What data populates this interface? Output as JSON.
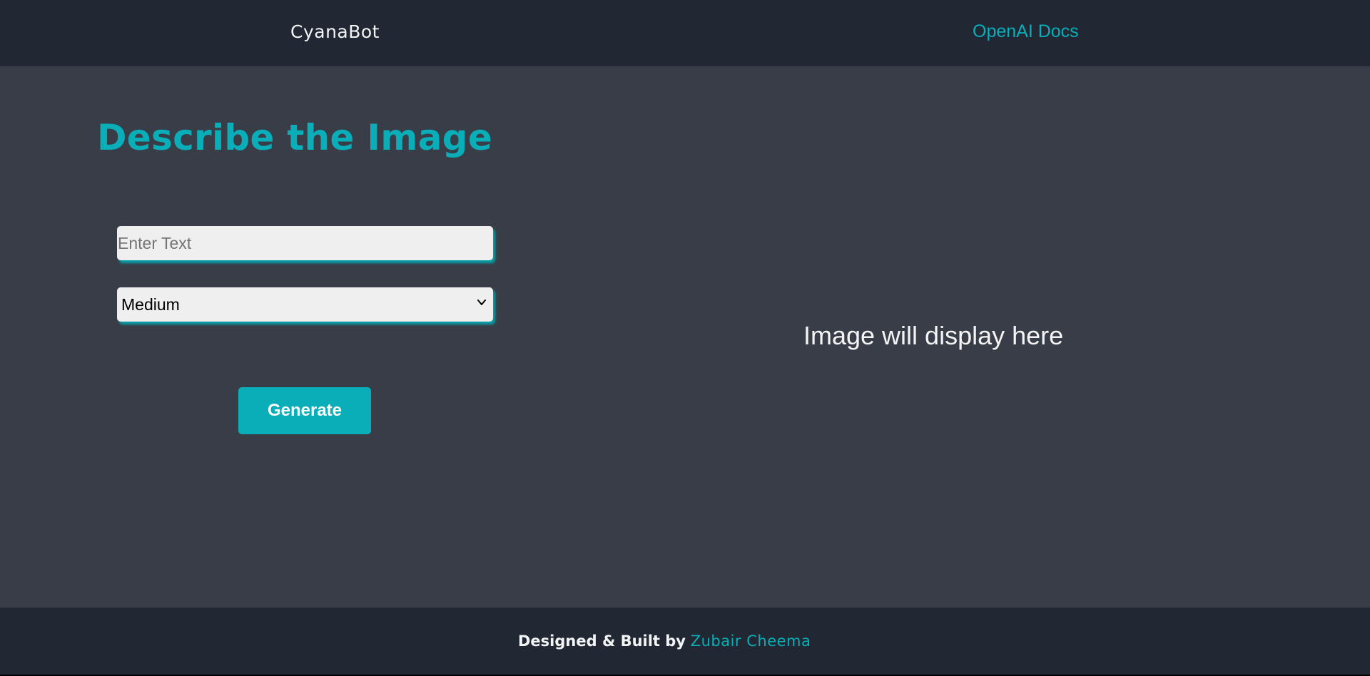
{
  "header": {
    "brand": "CyanaBot",
    "docs_link": "OpenAI Docs"
  },
  "form": {
    "heading": "Describe the Image",
    "text_placeholder": "Enter Text",
    "text_value": "",
    "size_selected": "Medium",
    "generate_label": "Generate"
  },
  "preview": {
    "placeholder": "Image will display here"
  },
  "footer": {
    "prefix": "Designed & Built by",
    "author": "Zubair Cheema"
  },
  "colors": {
    "accent": "#0aaeb8",
    "header_bg": "#212733",
    "main_bg": "#393d48",
    "text_light": "#f3f4f5",
    "input_bg": "#efefef"
  },
  "icons": {
    "select": "chevron-down-icon"
  }
}
